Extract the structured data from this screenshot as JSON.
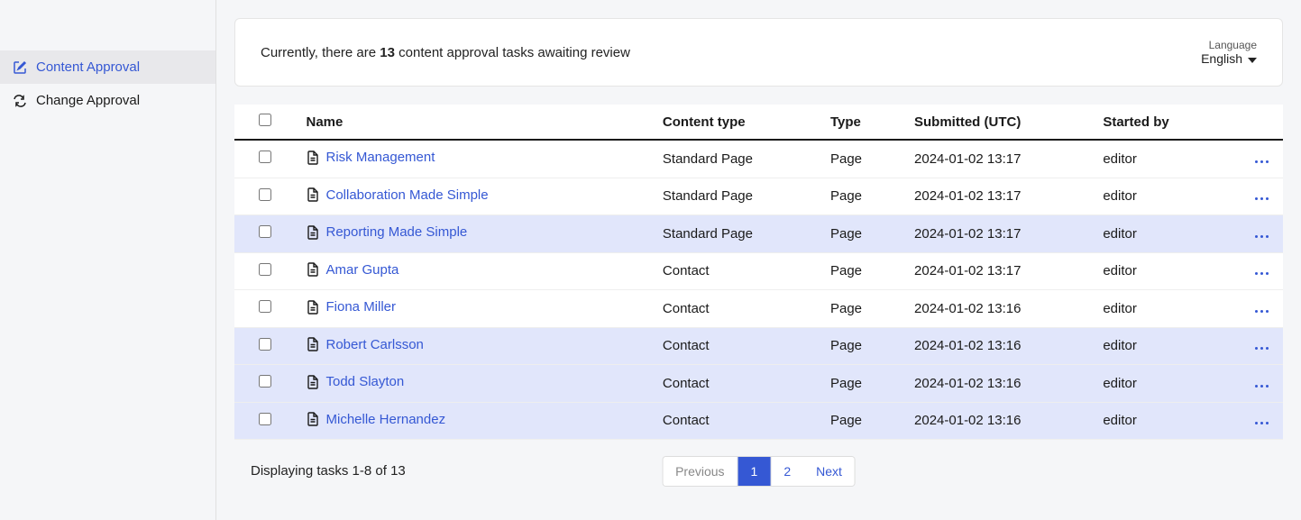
{
  "sidebar": {
    "items": [
      {
        "label": "Content Approval",
        "active": true
      },
      {
        "label": "Change Approval",
        "active": false
      }
    ]
  },
  "header": {
    "status_prefix": "Currently, there are ",
    "status_count": "13",
    "status_suffix": " content approval tasks awaiting review",
    "language_label": "Language",
    "language_value": "English"
  },
  "table": {
    "headers": {
      "name": "Name",
      "content_type": "Content type",
      "type": "Type",
      "submitted": "Submitted (UTC)",
      "started_by": "Started by"
    },
    "rows": [
      {
        "name": "Risk Management",
        "content_type": "Standard Page",
        "type": "Page",
        "submitted": "2024-01-02 13:17",
        "started_by": "editor",
        "zebra": false
      },
      {
        "name": "Collaboration Made Simple",
        "content_type": "Standard Page",
        "type": "Page",
        "submitted": "2024-01-02 13:17",
        "started_by": "editor",
        "zebra": false
      },
      {
        "name": "Reporting Made Simple",
        "content_type": "Standard Page",
        "type": "Page",
        "submitted": "2024-01-02 13:17",
        "started_by": "editor",
        "zebra": true
      },
      {
        "name": "Amar Gupta",
        "content_type": "Contact",
        "type": "Page",
        "submitted": "2024-01-02 13:17",
        "started_by": "editor",
        "zebra": false
      },
      {
        "name": "Fiona Miller",
        "content_type": "Contact",
        "type": "Page",
        "submitted": "2024-01-02 13:16",
        "started_by": "editor",
        "zebra": false
      },
      {
        "name": "Robert Carlsson",
        "content_type": "Contact",
        "type": "Page",
        "submitted": "2024-01-02 13:16",
        "started_by": "editor",
        "zebra": true
      },
      {
        "name": "Todd Slayton",
        "content_type": "Contact",
        "type": "Page",
        "submitted": "2024-01-02 13:16",
        "started_by": "editor",
        "zebra": true
      },
      {
        "name": "Michelle Hernandez",
        "content_type": "Contact",
        "type": "Page",
        "submitted": "2024-01-02 13:16",
        "started_by": "editor",
        "zebra": true
      }
    ]
  },
  "footer": {
    "display_text": "Displaying tasks 1-8 of 13",
    "pagination": {
      "prev": "Previous",
      "pages": [
        "1",
        "2"
      ],
      "active_index": 0,
      "next": "Next"
    }
  }
}
